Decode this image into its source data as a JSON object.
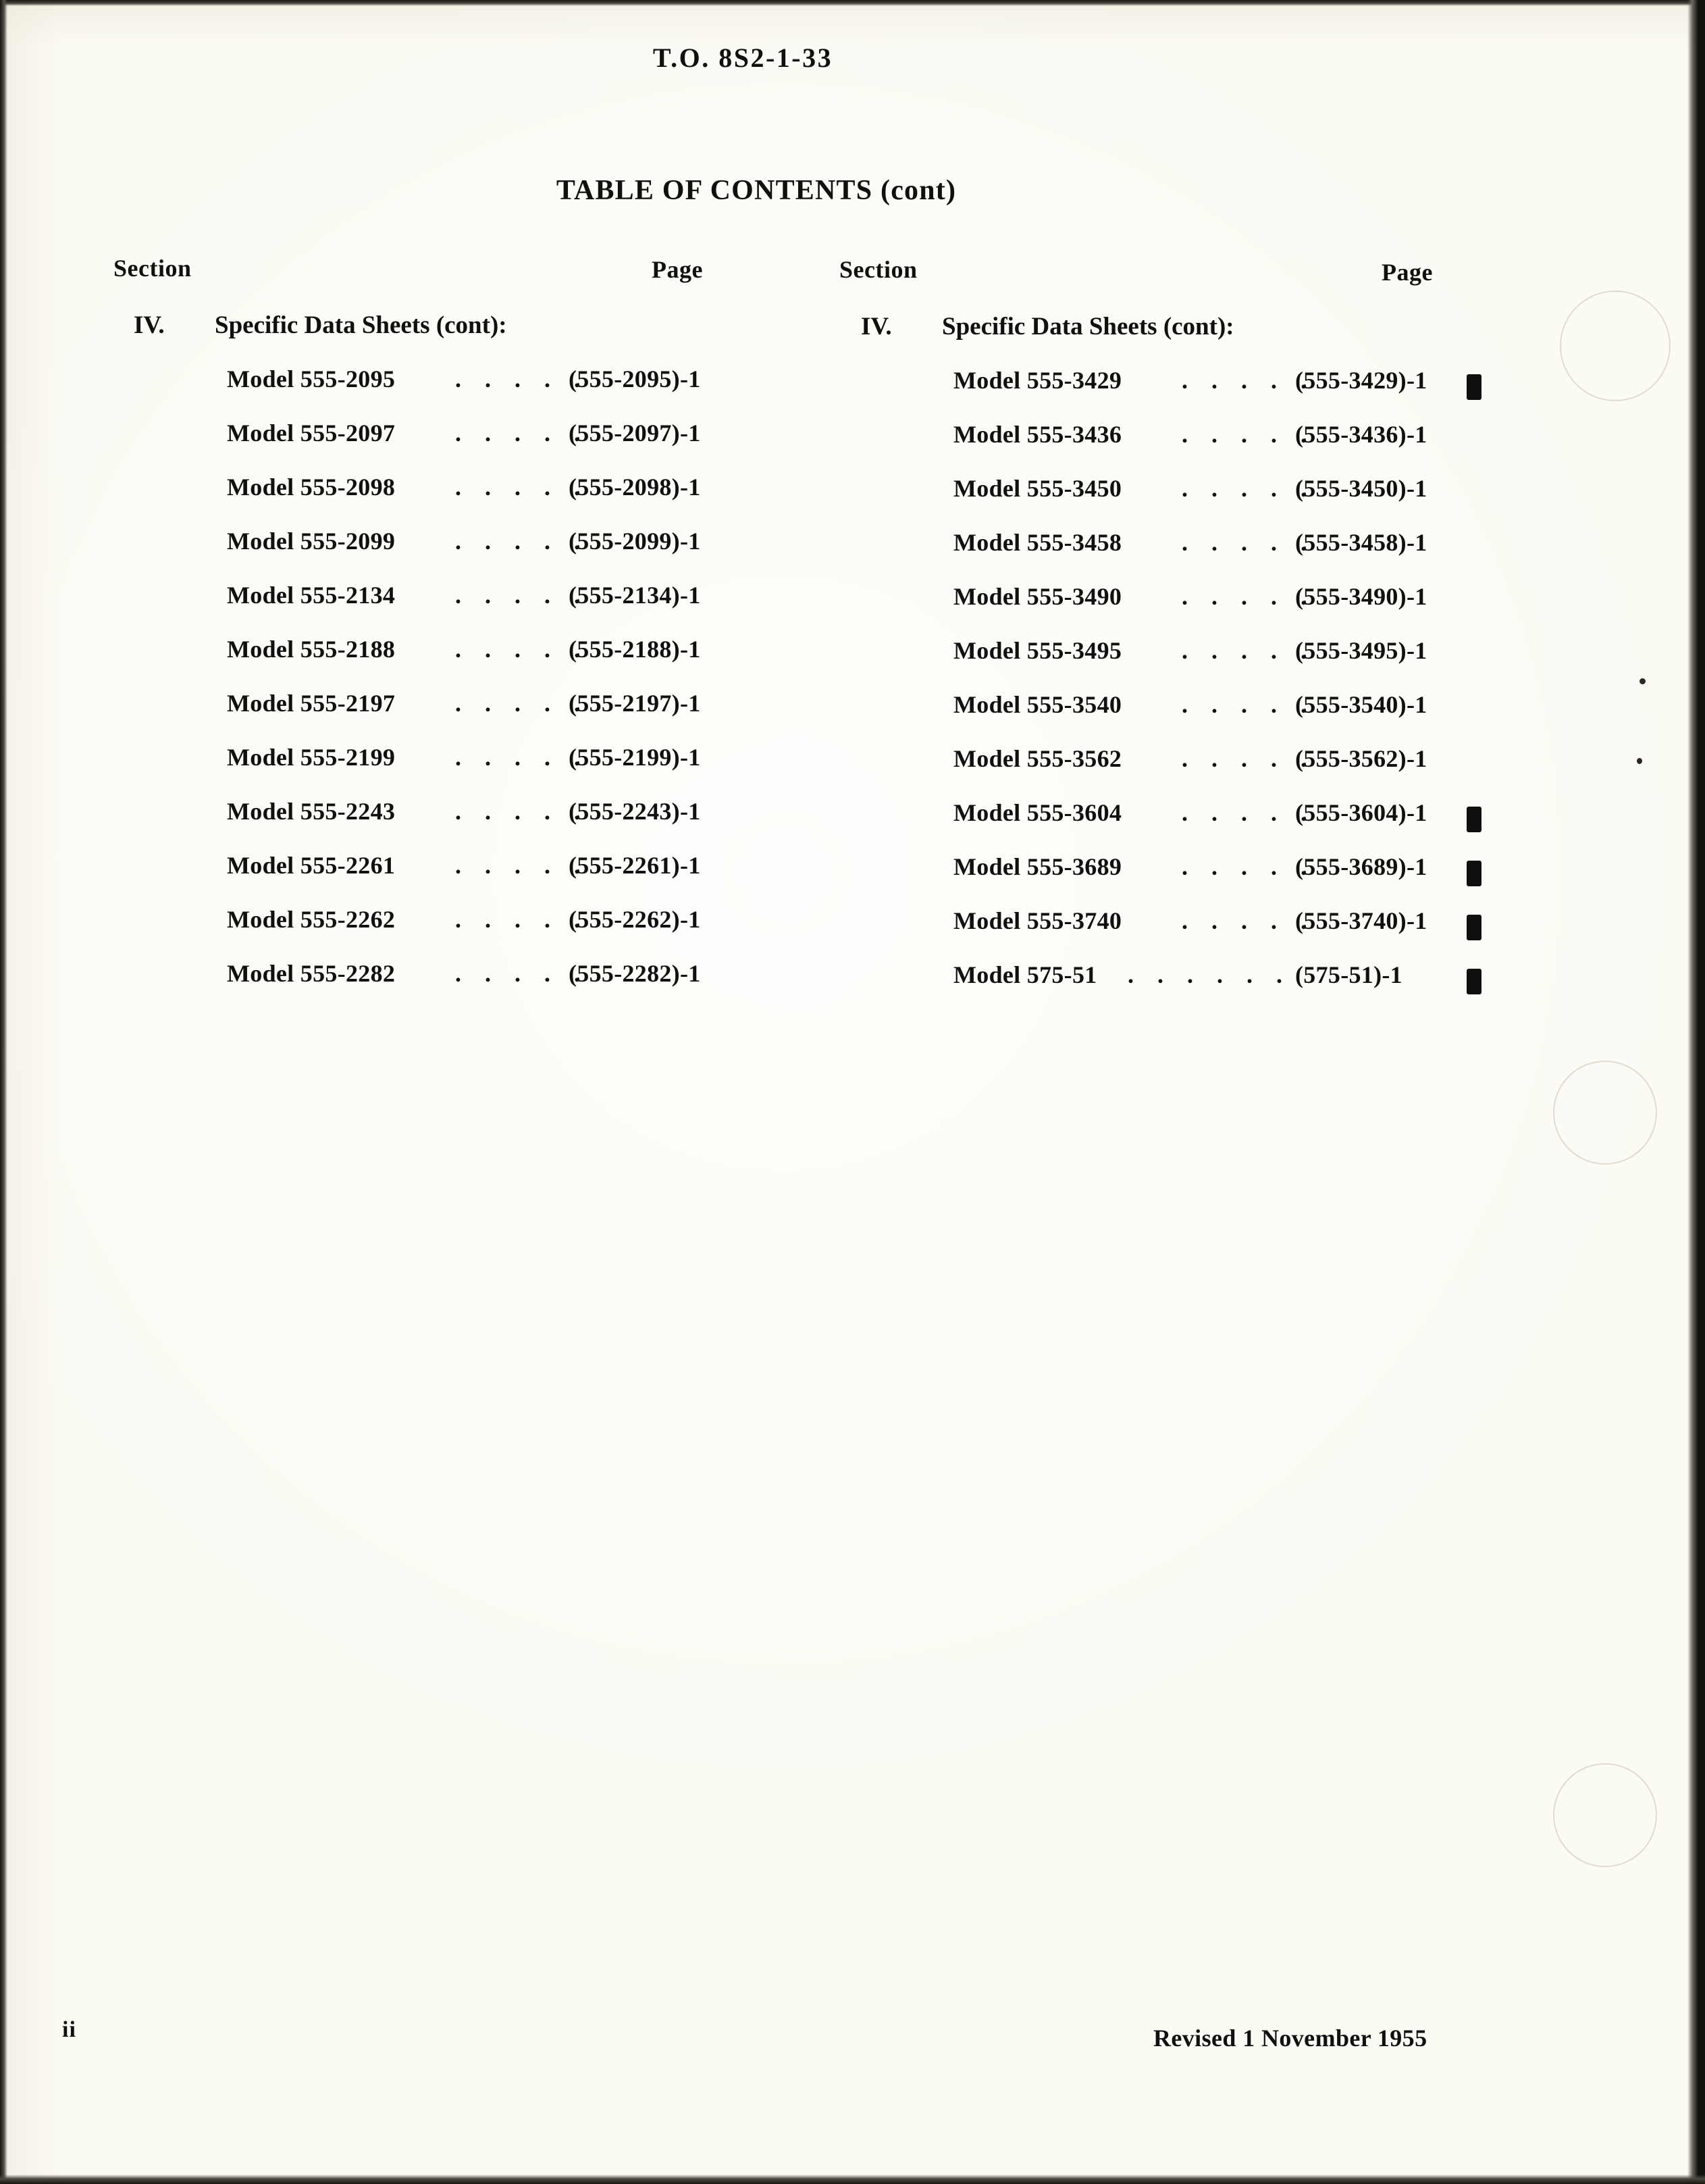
{
  "document": {
    "number": "T.O.  8S2-1-33",
    "title": "TABLE OF CONTENTS (cont)",
    "page_folio": "ii",
    "revision": "Revised 1 November 1955"
  },
  "columns": {
    "left": {
      "headers": {
        "section": "Section",
        "page": "Page"
      },
      "section": {
        "number": "IV.",
        "title": "Specific Data Sheets (cont):"
      },
      "entries": [
        {
          "label": "Model 555-2095",
          "leader": ". . . . .",
          "pageref": "(555-2095)-1",
          "change_bar": false
        },
        {
          "label": "Model 555-2097",
          "leader": ". . . . .",
          "pageref": "(555-2097)-1",
          "change_bar": false
        },
        {
          "label": "Model 555-2098",
          "leader": ". . . . .",
          "pageref": "(555-2098)-1",
          "change_bar": false
        },
        {
          "label": "Model 555-2099",
          "leader": ". . . . .",
          "pageref": "(555-2099)-1",
          "change_bar": false
        },
        {
          "label": "Model 555-2134",
          "leader": ". . . . .",
          "pageref": "(555-2134)-1",
          "change_bar": false
        },
        {
          "label": "Model 555-2188",
          "leader": ". . . . .",
          "pageref": "(555-2188)-1",
          "change_bar": false
        },
        {
          "label": "Model 555-2197",
          "leader": ". . . . .",
          "pageref": "(555-2197)-1",
          "change_bar": false
        },
        {
          "label": "Model 555-2199",
          "leader": ". . . . .",
          "pageref": "(555-2199)-1",
          "change_bar": false
        },
        {
          "label": "Model 555-2243",
          "leader": ". . . . .",
          "pageref": "(555-2243)-1",
          "change_bar": false
        },
        {
          "label": "Model 555-2261",
          "leader": ". . . . .",
          "pageref": "(555-2261)-1",
          "change_bar": false
        },
        {
          "label": "Model 555-2262",
          "leader": ". . . . .",
          "pageref": "(555-2262)-1",
          "change_bar": false
        },
        {
          "label": "Model 555-2282",
          "leader": ". . . . .",
          "pageref": "(555-2282)-1",
          "change_bar": false
        }
      ]
    },
    "right": {
      "headers": {
        "section": "Section",
        "page": "Page"
      },
      "section": {
        "number": "IV.",
        "title": "Specific Data Sheets (cont):"
      },
      "entries": [
        {
          "label": "Model 555-3429",
          "leader": ". . . . .",
          "pageref": "(555-3429)-1",
          "change_bar": true
        },
        {
          "label": "Model 555-3436",
          "leader": ". . . . .",
          "pageref": "(555-3436)-1",
          "change_bar": false
        },
        {
          "label": "Model 555-3450",
          "leader": ". . . . .",
          "pageref": "(555-3450)-1",
          "change_bar": false
        },
        {
          "label": "Model 555-3458",
          "leader": ". . . . .",
          "pageref": "(555-3458)-1",
          "change_bar": false
        },
        {
          "label": "Model 555-3490",
          "leader": ". . . . .",
          "pageref": "(555-3490)-1",
          "change_bar": false
        },
        {
          "label": "Model 555-3495",
          "leader": ". . . . .",
          "pageref": "(555-3495)-1",
          "change_bar": false
        },
        {
          "label": "Model 555-3540",
          "leader": ". . . . .",
          "pageref": "(555-3540)-1",
          "change_bar": false
        },
        {
          "label": "Model 555-3562",
          "leader": ". . . . .",
          "pageref": "(555-3562)-1",
          "change_bar": false
        },
        {
          "label": "Model 555-3604",
          "leader": ". . . . .",
          "pageref": "(555-3604)-1",
          "change_bar": true
        },
        {
          "label": "Model 555-3689",
          "leader": ". . . . .",
          "pageref": "(555-3689)-1",
          "change_bar": true
        },
        {
          "label": "Model 555-3740",
          "leader": ". . . . .",
          "pageref": "(555-3740)-1",
          "change_bar": true
        },
        {
          "label": "Model 575-51",
          "leader": ". . . . . .",
          "pageref": "(575-51)-1",
          "change_bar": true,
          "short": true
        }
      ]
    }
  }
}
